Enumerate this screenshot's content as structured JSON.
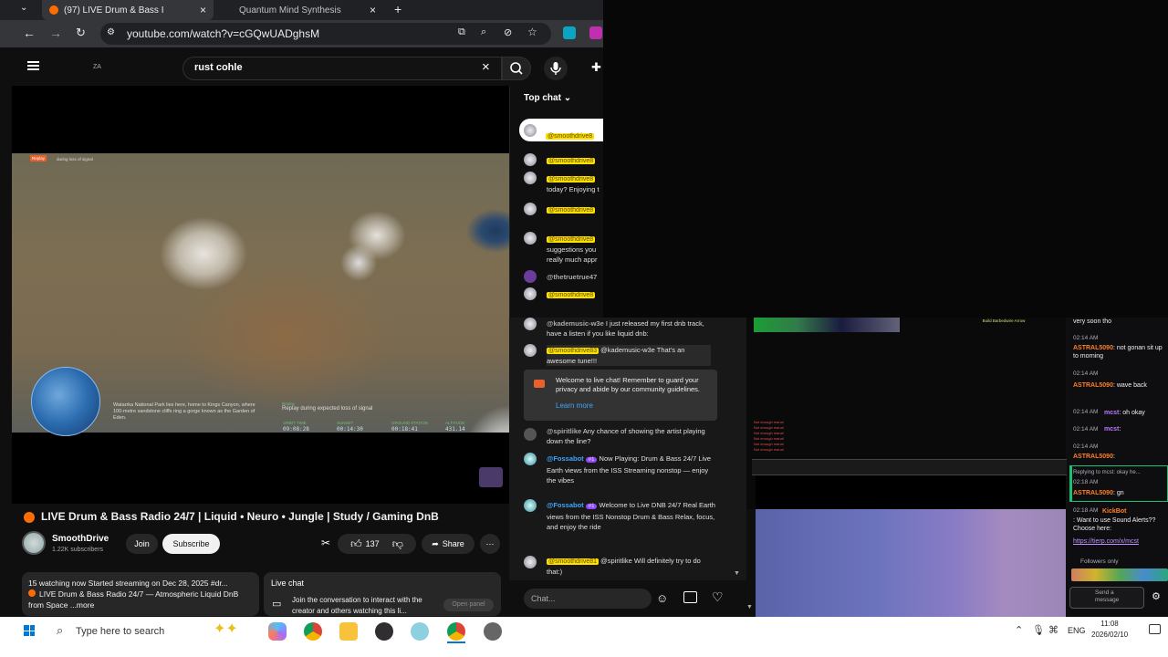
{
  "browser": {
    "tabs": [
      {
        "label": "(97)  LIVE Drum & Bass I"
      },
      {
        "label": "Quantum Mind Synthesis"
      }
    ],
    "url": "youtube.com/watch?v=cGQwUADghsM"
  },
  "yt": {
    "logo_text": "ZA",
    "search_value": "rust cohle"
  },
  "video": {
    "replay_badge": "Replay",
    "replay_sub": "during loss of signal",
    "caption_left": "Watarrka National Park lies here, home to Kings Canyon, where 100-metre sandstone cliffs ring a gorge known as the Garden of Eden.",
    "caption_replay_title": "Replay",
    "caption_replay": "Replay during expected loss of signal",
    "stats": [
      {
        "label": "ORBIT TIME",
        "value": "09:08:28"
      },
      {
        "label": "SUNSET",
        "value": "00:14:30"
      },
      {
        "label": "GROUND STATION",
        "value": "00:18:41"
      },
      {
        "label": "ALTITUDE",
        "value": "431.14"
      }
    ],
    "title": "LIVE Drum & Bass Radio 24/7 | Liquid • Neuro • Jungle | Study / Gaming DnB"
  },
  "channel": {
    "name": "SmoothDrive",
    "subs": "1.22K subscribers",
    "join": "Join",
    "subscribe": "Subscribe",
    "likes": "137",
    "share": "Share"
  },
  "description": {
    "line1": "15 watching now  Started streaming on Dec 28, 2025  #dr...",
    "line2": "LIVE Drum & Bass Radio 24/7 — Atmospheric Liquid DnB",
    "line3": "from Space",
    "more": "...more"
  },
  "livechat_box": {
    "title": "Live chat",
    "text": "Join the conversation to interact with the creator and others watching this li...",
    "open_panel": "Open panel"
  },
  "chat": {
    "header": "Top chat",
    "pinned_name": "@smoothdrive8",
    "messages": [
      {
        "name": "@smoothdrive8",
        "text": ""
      },
      {
        "name": "@smoothdrive8",
        "text": "today? Enjoying t"
      },
      {
        "name": "@smoothdrive8",
        "text": ""
      },
      {
        "name": "@smoothdrive8",
        "text": "suggestions you really much appr"
      },
      {
        "name": "@thetruetrue47",
        "text": ""
      },
      {
        "name": "@smoothdrive8",
        "text": ""
      },
      {
        "name": "@kademusic-w3e",
        "text": "I just released my first dnb track, have a listen if you like liquid dnb:"
      },
      {
        "name": "@smoothdrive83",
        "text": "@kademusic-w3e That's an awesome tune!!!"
      }
    ],
    "welcome": "Welcome to live chat! Remember to guard your privacy and abide by our community guidelines.",
    "learn_more": "Learn more",
    "messages2": [
      {
        "name": "@spiritlike",
        "text": "Any chance of showing the artist playing down the line?"
      },
      {
        "name": "@Fossabot",
        "badge": "#1",
        "text": "Now Playing: Drum & Bass 24/7  Live Earth views from the ISS  Streaming nonstop — enjoy the vibes"
      },
      {
        "name": "@Fossabot",
        "badge": "#1",
        "text": "Welcome to Live DNB 24/7 Real Earth views from the ISS  Nonstop Drum & Bass  Relax, focus, and enjoy the ride"
      },
      {
        "name": "@smoothdrive81",
        "text": "@spiritlike Will definitely try to do that:)"
      }
    ],
    "input_placeholder": "Chat..."
  },
  "twitch": {
    "top_text": "very soon tho",
    "lines": [
      {
        "time": "02:14 AM",
        "name": "ASTRAL5090",
        "text": ": not gonan sit up to morning"
      },
      {
        "time": "02:14 AM",
        "name": "ASTRAL5090",
        "text": ": wave back"
      },
      {
        "time": "02:14 AM",
        "name": "mcst",
        "text": ": oh okay"
      },
      {
        "time": "02:14 AM",
        "name": "mcst",
        "text": ":"
      },
      {
        "time": "02:14 AM",
        "name": "ASTRAL5090",
        "text": ":"
      }
    ],
    "reply_text": "Replying to mcst: okay he...",
    "reply_time": "02:18 AM",
    "reply_name": "ASTRAL5090",
    "reply_msg": ": gn",
    "bot_time": "02:18 AM",
    "bot_name": "KickBot",
    "bot_text": ": Want to use Sound Alerts?? Choose here:",
    "bot_link": "https://tierp.com/x/mcst",
    "followers": "Followers only",
    "send": "Send a message"
  },
  "game": {
    "hud_left": "Not enough mana!",
    "hud_right": "Build Barbedwire Arrow"
  },
  "taskbar": {
    "search": "Type here to search",
    "lang": "ENG",
    "time": "11:08",
    "date": "2026/02/10"
  }
}
